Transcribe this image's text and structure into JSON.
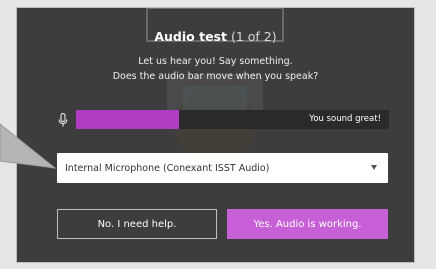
{
  "dialog": {
    "title": "Audio test",
    "step": "(1 of 2)",
    "line1": "Let us hear you! Say something.",
    "line2": "Does the audio bar move when you speak?"
  },
  "meter": {
    "level": 0.33,
    "status": "You sound great!",
    "fill_color": "#b03cc4",
    "icon": "microphone-icon"
  },
  "device_select": {
    "value": "Internal Microphone (Conexant ISST Audio)",
    "icon": "chevron-down-icon"
  },
  "buttons": {
    "no_label": "No. I need help.",
    "yes_label": "Yes. Audio is working.",
    "yes_color": "#c75fd6"
  }
}
